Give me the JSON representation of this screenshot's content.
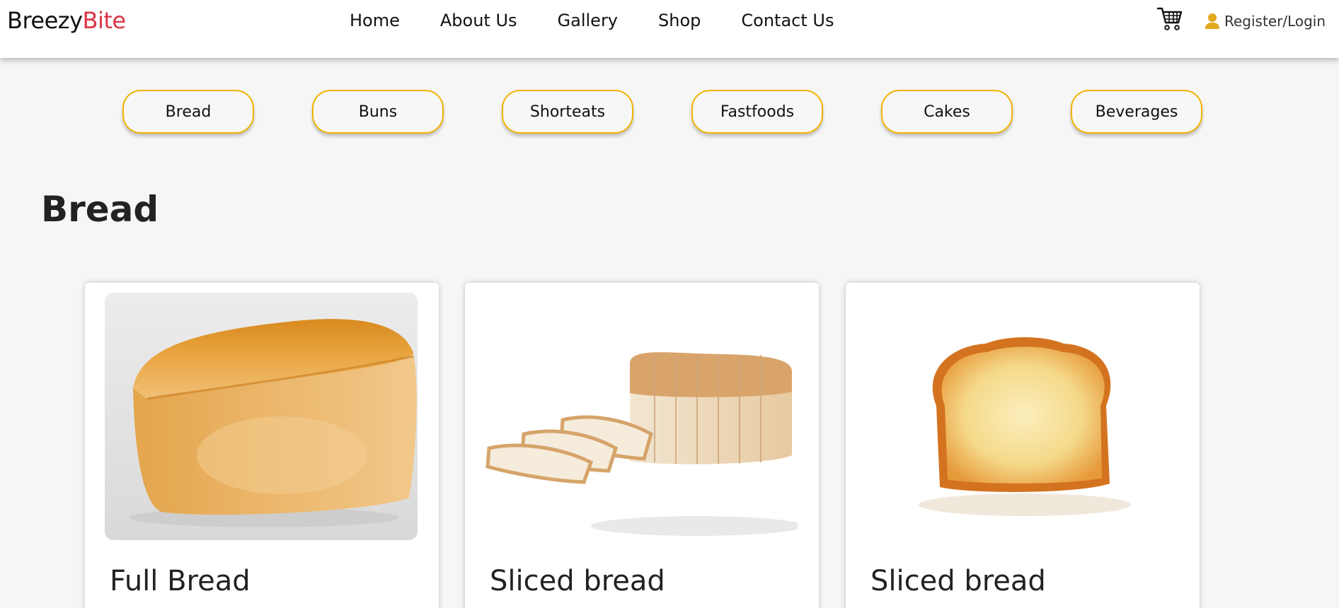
{
  "brand": {
    "part1": "Breezy",
    "part2": "Bite"
  },
  "nav": {
    "links": [
      "Home",
      "About Us",
      "Gallery",
      "Shop",
      "Contact Us"
    ],
    "login_label": "Register/Login",
    "cart_icon": "cart-icon",
    "user_icon": "user-icon"
  },
  "categories": [
    "Bread",
    "Buns",
    "Shorteats",
    "Fastfoods",
    "Cakes",
    "Beverages"
  ],
  "section": {
    "title": "Bread"
  },
  "products": [
    {
      "title": "Full Bread"
    },
    {
      "title": "Sliced bread"
    },
    {
      "title": "Sliced bread"
    }
  ],
  "colors": {
    "brand_accent": "#dc3545",
    "pill_border": "#f1b400",
    "user_icon": "#e0a91e",
    "background": "#f6f6f6"
  }
}
